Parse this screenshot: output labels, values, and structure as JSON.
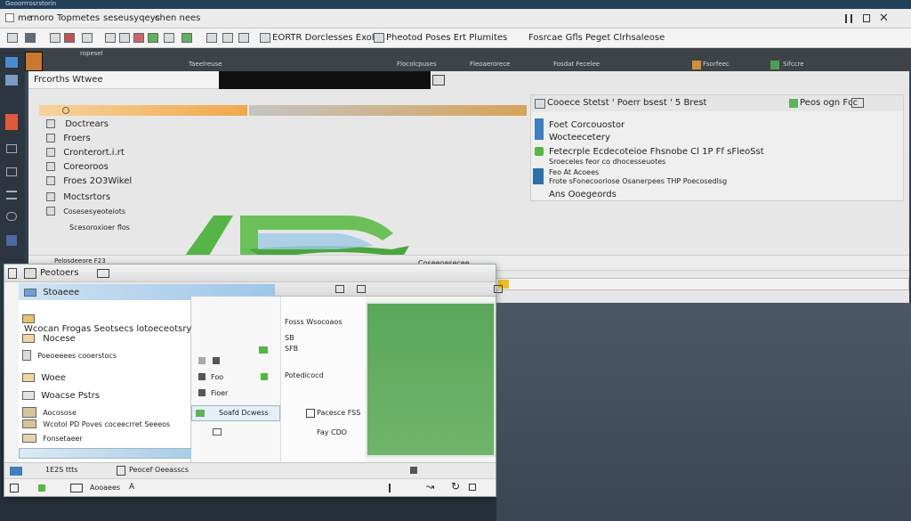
{
  "titlebar": {
    "text": "Gooorrrosrstorin"
  },
  "menubar": {
    "items": [
      "me",
      "rnoro",
      "Topmetes",
      "seseusyqeys",
      "chen nees"
    ]
  },
  "toolbar": {
    "label_1": "EORTR Dorclesses Exolirs",
    "label_2": "Pheotod Poses Ert Plumites",
    "label_3": "Fosrcae Gfls Peget Clrhsaleose"
  },
  "tabs_row": {
    "items": [
      "ropesel",
      "Taeelreuse",
      "Flocolcpuses",
      "Fleoaerorece",
      "Fosdat Fecelee",
      "Fsorfeec",
      "Sifccre"
    ]
  },
  "left_panel": {
    "title": "Frcorths Wtwee",
    "items": [
      "Doctrears",
      "Froers",
      "Cronterort.i.rt",
      "Coreoroos",
      "Froes 2O3Wikel",
      "Moctsrtors",
      "Cosesesyeoteiots",
      "Scesoroxioer flos"
    ]
  },
  "right_panel": {
    "header": "Cooece Stetst  ' Poerr bsest  ' 5 Brest",
    "header_right": "Peos ogn Fcc",
    "lines": [
      "Foet Corcouostor",
      "Wocteecetery",
      "Fetecrple Ecdecoteioe Fhsnobe Cl 1P Ff sFleoSst",
      "Sroeceles feor co dhocesseuotes",
      "Feo At Acoees",
      "Frote sFonecooriose Osanerpees THP Poecosedlsg",
      "Ans Ooegeords"
    ]
  },
  "bar_text": "Coseeoesecee",
  "dialog": {
    "title": "Peotoers",
    "tab_label": "Pelosdeeore  F23",
    "items": [
      "Stoaeee",
      "Wcocan Frogas Seotsecs lotoeceotsry",
      "Nocese",
      "Poeoeeees cooerstocs",
      "Woee",
      "Woacse Pstrs",
      "Aocosose",
      "Wcotol PD Poves coceecrret Seeeos",
      "Fonsetaeer"
    ],
    "mid_labels": [
      "Foo",
      "Fioer"
    ],
    "mid_button": "Soafd Dcwess",
    "col_right": [
      "Fosss Wsocoaos",
      "SB",
      "SFB",
      "Potedicocd"
    ],
    "bottom_right": "Pacesce FSS",
    "bottom_value": "Fay CDO",
    "footer_left": "1E2S ttts",
    "footer_right": "Peocef Oeeasscs",
    "status_left": "Aooaees",
    "status_a": "A"
  },
  "colors": {
    "accent_orange": "#f0a94b",
    "accent_green": "#5fb15d",
    "arrow_green": "#57b548"
  }
}
